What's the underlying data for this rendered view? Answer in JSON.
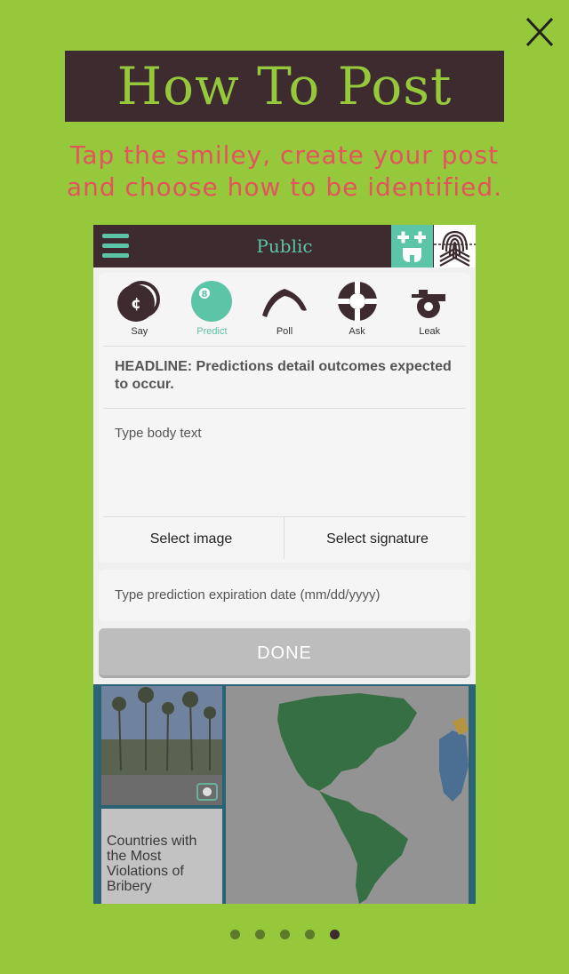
{
  "overlay": {
    "title": "How To Post",
    "subtitle_line1": "Tap the smiley, create your post",
    "subtitle_line2": "and choose how to be identified."
  },
  "app": {
    "bar_title": "Public",
    "post_types": [
      {
        "label": "Say",
        "icon": "cent-coin-icon",
        "active": false
      },
      {
        "label": "Predict",
        "icon": "eight-ball-icon",
        "active": true
      },
      {
        "label": "Poll",
        "icon": "boomerang-icon",
        "active": false
      },
      {
        "label": "Ask",
        "icon": "lifebuoy-icon",
        "active": false
      },
      {
        "label": "Leak",
        "icon": "whistle-icon",
        "active": false
      }
    ],
    "headline": "HEADLINE: Predictions detail outcomes expected to occur.",
    "body_placeholder": "Type body text",
    "select_image": "Select image",
    "select_signature": "Select signature",
    "expiration_placeholder": "Type prediction expiration date (mm/dd/yyyy)",
    "done_label": "DONE"
  },
  "feed": {
    "article_title": "Countries with the Most Violations of Bribery"
  },
  "pagination": {
    "total": 5,
    "current": 5
  },
  "colors": {
    "background": "#96c83c",
    "dark": "#3d2b2f",
    "accent": "#5cc4a7",
    "subtitle": "#e4545c"
  }
}
